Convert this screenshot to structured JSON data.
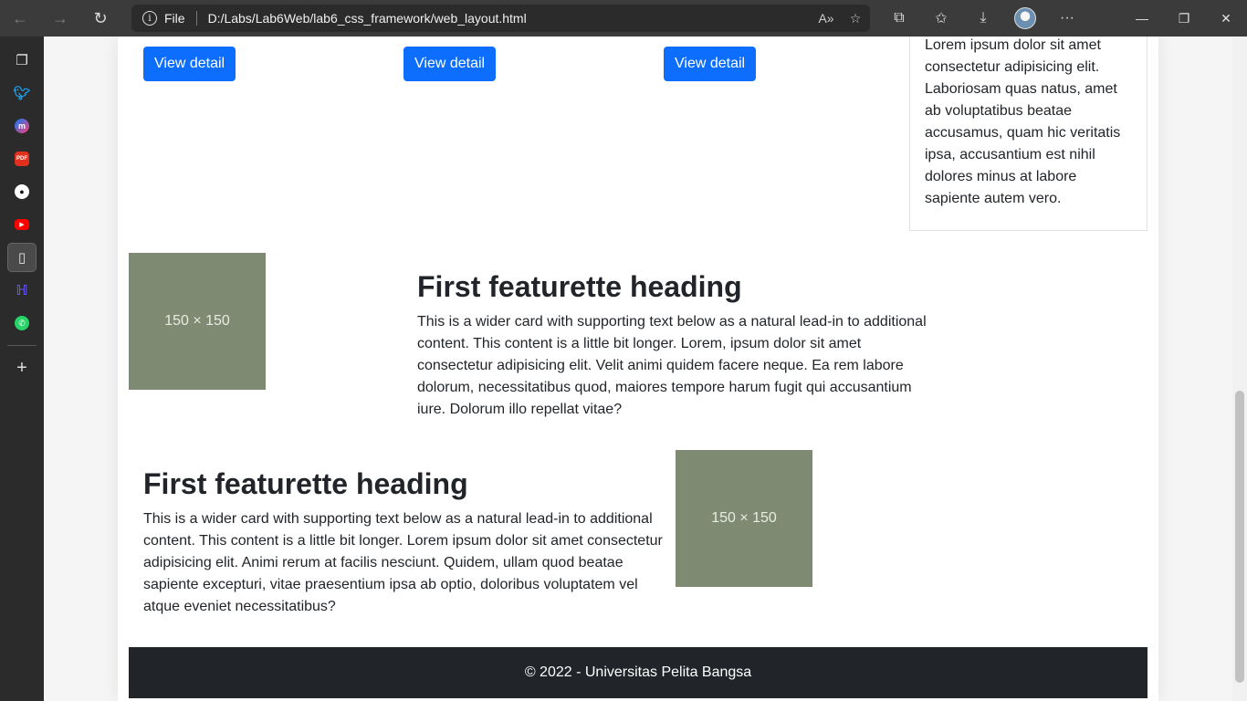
{
  "browser": {
    "address": {
      "scheme_label": "File",
      "url": "D:/Labs/Lab6Web/lab6_css_framework/web_layout.html"
    }
  },
  "sidebar": {
    "items": [
      {
        "name": "sidebar-item-tabs",
        "glyph": "❐"
      },
      {
        "name": "sidebar-item-twitter",
        "glyph": "t"
      },
      {
        "name": "sidebar-item-messenger",
        "glyph": "m"
      },
      {
        "name": "sidebar-item-pdf",
        "glyph": "PDF"
      },
      {
        "name": "sidebar-item-github",
        "glyph": "⌥"
      },
      {
        "name": "sidebar-item-youtube",
        "glyph": "▶"
      },
      {
        "name": "sidebar-item-page",
        "glyph": "▢"
      },
      {
        "name": "sidebar-item-app",
        "glyph": "H"
      },
      {
        "name": "sidebar-item-whatsapp",
        "glyph": "✆"
      }
    ],
    "add_glyph": "+"
  },
  "cards": {
    "buttons": [
      "View detail",
      "View detail",
      "View detail"
    ]
  },
  "aside": {
    "text": "Lorem ipsum dolor sit amet consectetur adipisicing elit. Laboriosam quas natus, amet ab voluptatibus beatae accusamus, quam hic veritatis ipsa, accusantium est nihil dolores minus at labore sapiente autem vero."
  },
  "featurettes": [
    {
      "heading": "First featurette heading",
      "text": "This is a wider card with supporting text below as a natural lead-in to additional content. This content is a little bit longer. Lorem, ipsum dolor sit amet consectetur adipisicing elit. Velit animi quidem facere neque. Ea rem labore dolorum, necessitatibus quod, maiores tempore harum fugit qui accusantium iure. Dolorum illo repellat vitae?",
      "image_label": "150 × 150"
    },
    {
      "heading": "First featurette heading",
      "text": "This is a wider card with supporting text below as a natural lead-in to additional content. This content is a little bit longer. Lorem ipsum dolor sit amet consectetur adipisicing elit. Animi rerum at facilis nesciunt. Quidem, ullam quod beatae sapiente excepturi, vitae praesentium ipsa ab optio, doloribus voluptatem vel atque eveniet necessitatibus?",
      "image_label": "150 × 150"
    }
  ],
  "footer": {
    "text": "© 2022 - Universitas Pelita Bangsa"
  },
  "colors": {
    "primary": "#0d6efd",
    "placeholder": "#7f8a72",
    "footer_bg": "#212529"
  }
}
